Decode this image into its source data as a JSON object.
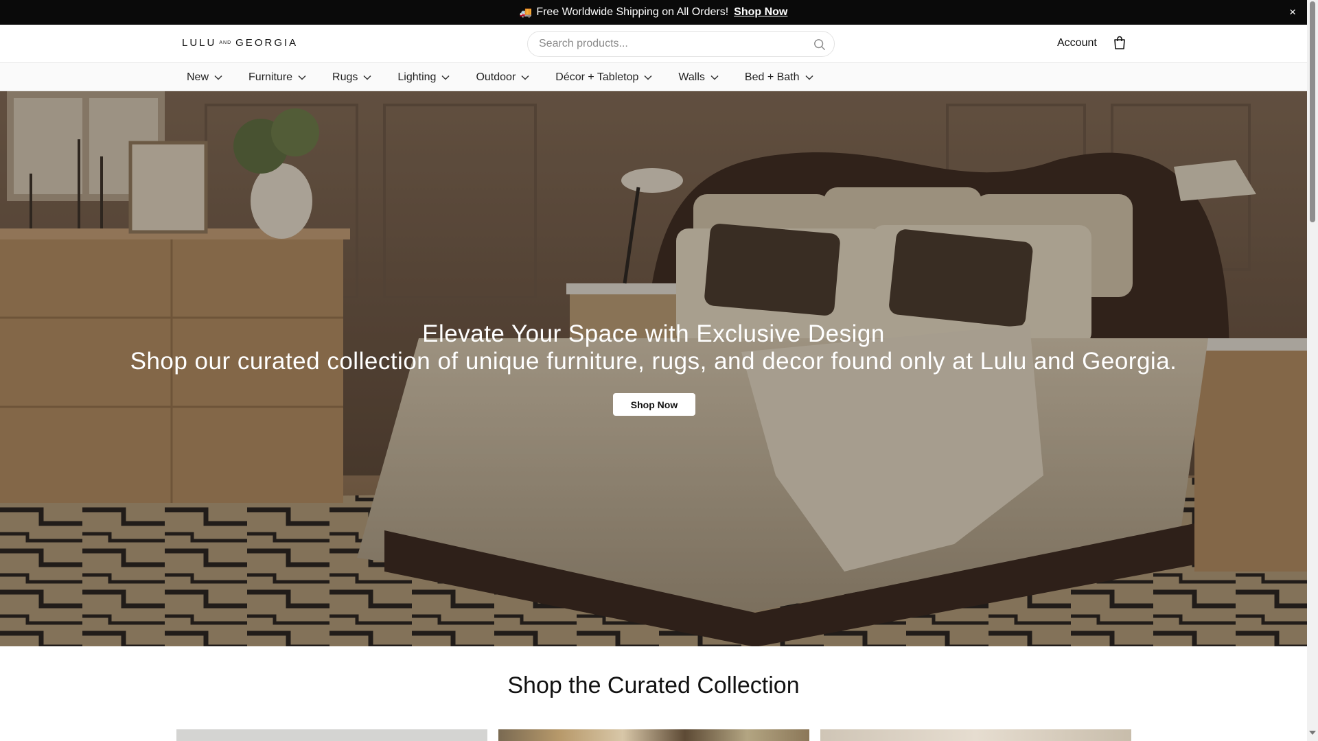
{
  "announcement": {
    "icon": "truck-icon",
    "text": "Free Worldwide Shipping on All Orders!",
    "link": "Shop Now",
    "close": "×"
  },
  "header": {
    "logo_left": "LULU",
    "logo_and": "AND",
    "logo_right": "GEORGIA",
    "search_placeholder": "Search products...",
    "account": "Account"
  },
  "nav": {
    "items": [
      {
        "label": "New"
      },
      {
        "label": "Furniture"
      },
      {
        "label": "Rugs"
      },
      {
        "label": "Lighting"
      },
      {
        "label": "Outdoor"
      },
      {
        "label": "Décor + Tabletop"
      },
      {
        "label": "Walls"
      },
      {
        "label": "Bed + Bath"
      }
    ]
  },
  "hero": {
    "heading": "Elevate Your Space with Exclusive Design",
    "subheading": "Shop our curated collection of unique furniture, rugs, and decor found only at Lulu and Georgia.",
    "cta": "Shop Now"
  },
  "collection": {
    "title": "Shop the Curated Collection"
  }
}
